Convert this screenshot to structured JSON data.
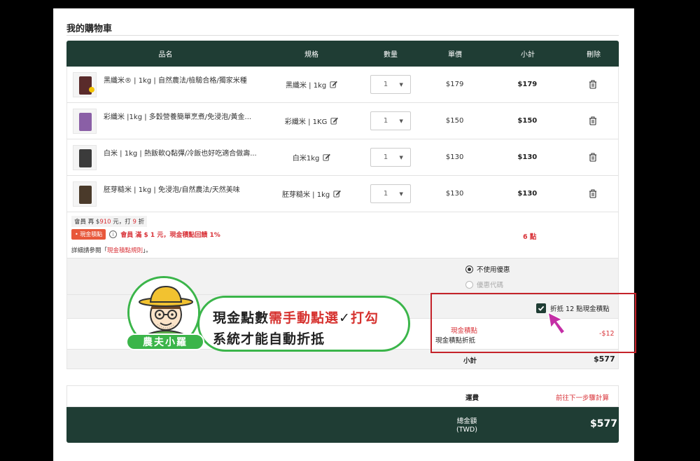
{
  "page_title": "我的購物車",
  "table": {
    "headers": [
      "品名",
      "規格",
      "數量",
      "單價",
      "小計",
      "刪除"
    ],
    "rows": [
      {
        "name": "黑纖米® | 1kg | 自然農法/檢驗合格/獨家米種",
        "spec": "黑纖米 | 1kg",
        "qty": "1",
        "price": "$179",
        "subtotal": "$179",
        "thumb_color": "#5a2b2b"
      },
      {
        "name": "彩纖米 |1kg | 多穀營養簡單烹煮/免浸泡/黃金...",
        "spec": "彩纖米 | 1KG",
        "qty": "1",
        "price": "$150",
        "subtotal": "$150",
        "thumb_color": "#8a5fa6"
      },
      {
        "name": "白米 | 1kg | 熱飯軟Q黏彈/冷飯也好吃適合做壽...",
        "spec": "白米1kg",
        "qty": "1",
        "price": "$130",
        "subtotal": "$130",
        "thumb_color": "#3b3b3b"
      },
      {
        "name": "胚芽糙米 | 1kg | 免浸泡/自然農法/天然美味",
        "spec": "胚芽糙米 | 1kg",
        "qty": "1",
        "price": "$130",
        "subtotal": "$130",
        "thumb_color": "#4a3a2a"
      }
    ]
  },
  "member": {
    "line1_prefix": "會員 再 $",
    "line1_amount": "910",
    "line1_mid": " 元，打 ",
    "line1_discount": "9",
    "line1_suffix": " 折",
    "badge": "• 現金積點",
    "info_glyph": "i",
    "promo": "會員 滿 $ 1 元，現金積點回饋 1%",
    "points": "6 點",
    "rules_prefix": "詳細請參閱「",
    "rules_link": "現金積點規則",
    "rules_suffix": "」。"
  },
  "coupon": {
    "option_none": "不使用優惠",
    "option_code": "優惠代碼"
  },
  "deduct": {
    "checkbox_label": "折抵 12 點現金積點",
    "checked": true
  },
  "points_row": {
    "label1": "現金積點",
    "label2": "現金積點折抵",
    "amount": "-$12"
  },
  "subtotal": {
    "label": "小計",
    "amount": "$577"
  },
  "shipping": {
    "label": "運費",
    "value": "前往下一步驟計算"
  },
  "total": {
    "label": "總金額",
    "currency": "(TWD)",
    "amount": "$577"
  },
  "annotation": {
    "line1_a": "現金點數",
    "line1_b": "需手動點選",
    "line1_check": "✓",
    "line1_c": "打勾",
    "line2": "系統才能自動折抵",
    "mascot_name": "農夫小羅"
  },
  "colors": {
    "header_green": "#1f3d34",
    "accent_red": "#d9343a",
    "annotation_green": "#3bb54a"
  }
}
